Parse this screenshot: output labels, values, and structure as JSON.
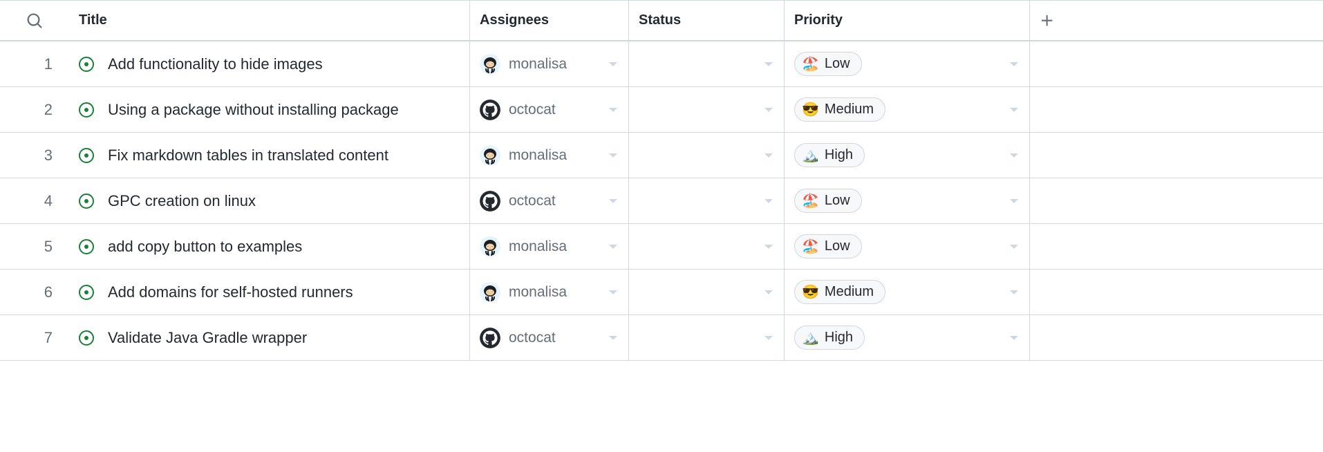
{
  "columns": {
    "title": "Title",
    "assignees": "Assignees",
    "status": "Status",
    "priority": "Priority"
  },
  "assignees": {
    "monalisa": {
      "name": "monalisa",
      "avatar": "octocat-anime"
    },
    "octocat": {
      "name": "octocat",
      "avatar": "github-mark"
    }
  },
  "priorities": {
    "low": {
      "label": "Low",
      "emoji": "🏖️"
    },
    "medium": {
      "label": "Medium",
      "emoji": "😎"
    },
    "high": {
      "label": "High",
      "emoji": "🏔️"
    }
  },
  "rows": [
    {
      "num": "1",
      "title": "Add functionality to hide images",
      "assignee": "monalisa",
      "status": "",
      "priority": "low"
    },
    {
      "num": "2",
      "title": "Using a package without installing package",
      "assignee": "octocat",
      "status": "",
      "priority": "medium"
    },
    {
      "num": "3",
      "title": "Fix markdown tables in translated content",
      "assignee": "monalisa",
      "status": "",
      "priority": "high"
    },
    {
      "num": "4",
      "title": "GPC creation on linux",
      "assignee": "octocat",
      "status": "",
      "priority": "low"
    },
    {
      "num": "5",
      "title": "add copy button to examples",
      "assignee": "monalisa",
      "status": "",
      "priority": "low"
    },
    {
      "num": "6",
      "title": "Add domains for self-hosted runners",
      "assignee": "monalisa",
      "status": "",
      "priority": "medium"
    },
    {
      "num": "7",
      "title": "Validate Java Gradle wrapper",
      "assignee": "octocat",
      "status": "",
      "priority": "high"
    }
  ]
}
